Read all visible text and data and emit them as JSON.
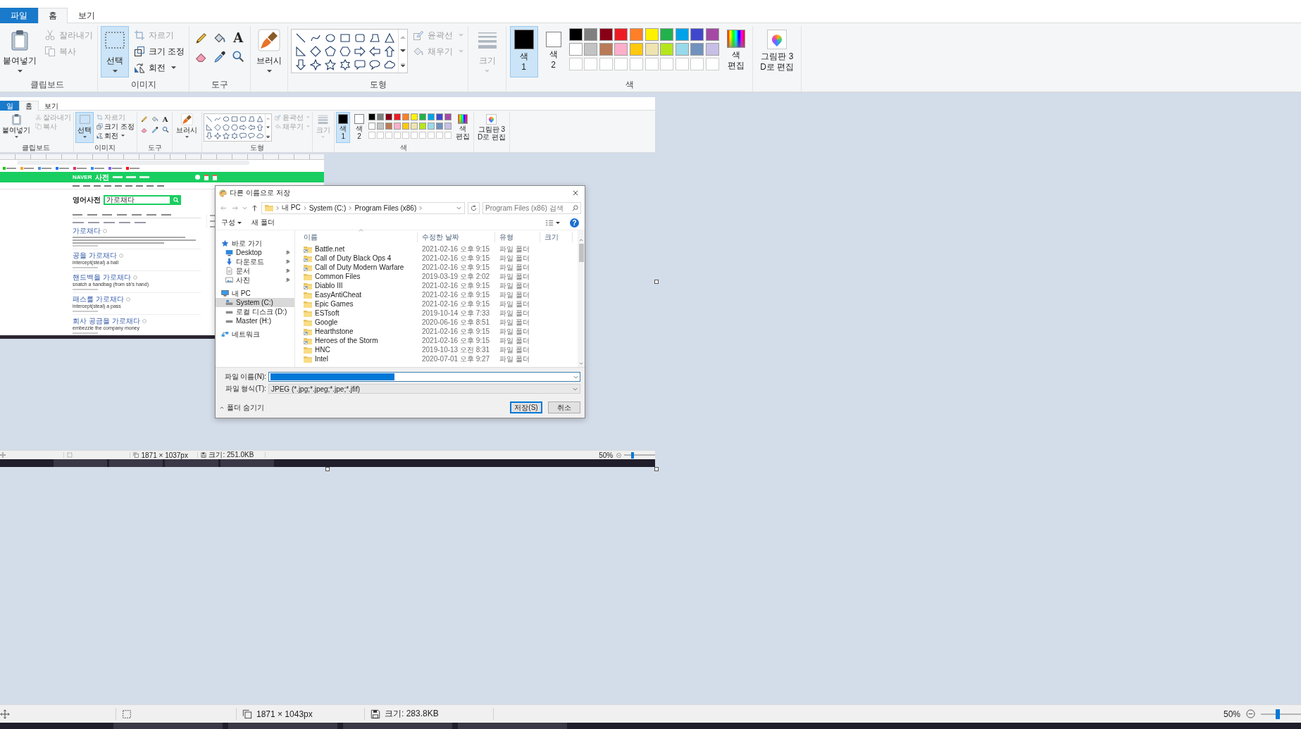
{
  "tabs": [
    {
      "label": "파일",
      "kind": "file",
      "selected": false
    },
    {
      "label": "홈",
      "kind": "tab",
      "selected": true
    },
    {
      "label": "보기",
      "kind": "tab",
      "selected": false
    }
  ],
  "ribbon": {
    "clipboard": {
      "label": "클립보드",
      "paste": "붙여넣기",
      "cut": {
        "label": "잘라내기",
        "disabled": true
      },
      "copy": {
        "label": "복사",
        "disabled": true
      }
    },
    "image": {
      "label": "이미지",
      "select": {
        "label": "선택",
        "selected": true
      },
      "crop": {
        "label": "자르기",
        "disabled": true
      },
      "resize": {
        "label": "크기 조정",
        "disabled": false
      },
      "rotate": {
        "label": "회전",
        "disabled": false
      }
    },
    "tools": {
      "label": "도구",
      "text_tool": "A"
    },
    "brushes": {
      "label": "브러시"
    },
    "shapes": {
      "label": "도형",
      "outline": {
        "label": "윤곽선",
        "disabled": true
      },
      "fill": {
        "label": "채우기",
        "disabled": true
      }
    },
    "size": {
      "label": "크기",
      "disabled": true
    },
    "colors": {
      "label": "색",
      "current": [
        {
          "lines": [
            "색",
            "1"
          ],
          "color": "#000000",
          "selected": true
        },
        {
          "lines": [
            "색",
            "2"
          ],
          "color": "#ffffff",
          "selected": false
        }
      ],
      "palette": [
        {
          "kind": "color",
          "color": "#000000"
        },
        {
          "kind": "color",
          "color": "#7f7f7f"
        },
        {
          "kind": "color",
          "color": "#880015"
        },
        {
          "kind": "color",
          "color": "#ed1c24"
        },
        {
          "kind": "color",
          "color": "#ff7f27"
        },
        {
          "kind": "color",
          "color": "#fff200"
        },
        {
          "kind": "color",
          "color": "#22b14c"
        },
        {
          "kind": "color",
          "color": "#00a2e8"
        },
        {
          "kind": "color",
          "color": "#3f48cc"
        },
        {
          "kind": "color",
          "color": "#a349a4"
        },
        {
          "kind": "color",
          "color": "#ffffff"
        },
        {
          "kind": "color",
          "color": "#c3c3c3"
        },
        {
          "kind": "color",
          "color": "#b97a57"
        },
        {
          "kind": "color",
          "color": "#ffaec9"
        },
        {
          "kind": "color",
          "color": "#ffc90e"
        },
        {
          "kind": "color",
          "color": "#efe4b0"
        },
        {
          "kind": "color",
          "color": "#b5e61d"
        },
        {
          "kind": "color",
          "color": "#99d9ea"
        },
        {
          "kind": "color",
          "color": "#7092be"
        },
        {
          "kind": "color",
          "color": "#c8bfe7"
        },
        {
          "kind": "empty"
        },
        {
          "kind": "empty"
        },
        {
          "kind": "empty"
        },
        {
          "kind": "empty"
        },
        {
          "kind": "empty"
        },
        {
          "kind": "empty"
        },
        {
          "kind": "empty"
        },
        {
          "kind": "empty"
        },
        {
          "kind": "empty"
        },
        {
          "kind": "empty"
        }
      ],
      "edit": {
        "lines": [
          "색",
          "편집"
        ]
      }
    },
    "paint3d": {
      "lines": [
        "그림판 3",
        "D로 편집"
      ]
    }
  },
  "canvas_image": {
    "tabs": [
      {
        "label": "일",
        "kind": "file",
        "selected": false
      },
      {
        "label": "홈",
        "kind": "tab",
        "selected": true
      },
      {
        "label": "보기",
        "kind": "tab",
        "selected": false
      }
    ],
    "ribbon": {
      "clipboard": {
        "label": "클립보드",
        "paste": "붙여넣기",
        "cut": {
          "label": "잘라내기",
          "disabled": true
        },
        "copy": {
          "label": "복사",
          "disabled": true
        }
      },
      "image": {
        "label": "이미지",
        "select": {
          "label": "선택",
          "selected": true
        },
        "crop": {
          "label": "자르기",
          "disabled": true
        },
        "resize": {
          "label": "크기 조정",
          "disabled": false
        },
        "rotate": {
          "label": "회전",
          "disabled": false
        }
      },
      "tools": {
        "label": "도구",
        "text_tool": "A"
      },
      "brushes": {
        "label": "브러시"
      },
      "shapes": {
        "label": "도형",
        "outline": {
          "label": "윤곽선",
          "disabled": true
        },
        "fill": {
          "label": "채우기",
          "disabled": true
        }
      },
      "size": {
        "label": "크기",
        "disabled": true
      },
      "colors": {
        "label": "색",
        "current": [
          {
            "lines": [
              "색",
              "1"
            ],
            "color": "#000000",
            "selected": true
          },
          {
            "lines": [
              "색",
              "2"
            ],
            "color": "#ffffff",
            "selected": false
          }
        ],
        "palette": [
          {
            "kind": "color",
            "color": "#000000"
          },
          {
            "kind": "color",
            "color": "#7f7f7f"
          },
          {
            "kind": "color",
            "color": "#880015"
          },
          {
            "kind": "color",
            "color": "#ed1c24"
          },
          {
            "kind": "color",
            "color": "#ff7f27"
          },
          {
            "kind": "color",
            "color": "#fff200"
          },
          {
            "kind": "color",
            "color": "#22b14c"
          },
          {
            "kind": "color",
            "color": "#00a2e8"
          },
          {
            "kind": "color",
            "color": "#3f48cc"
          },
          {
            "kind": "color",
            "color": "#a349a4"
          },
          {
            "kind": "color",
            "color": "#ffffff"
          },
          {
            "kind": "color",
            "color": "#c3c3c3"
          },
          {
            "kind": "color",
            "color": "#b97a57"
          },
          {
            "kind": "color",
            "color": "#ffaec9"
          },
          {
            "kind": "color",
            "color": "#ffc90e"
          },
          {
            "kind": "color",
            "color": "#efe4b0"
          },
          {
            "kind": "color",
            "color": "#b5e61d"
          },
          {
            "kind": "color",
            "color": "#99d9ea"
          },
          {
            "kind": "color",
            "color": "#7092be"
          },
          {
            "kind": "color",
            "color": "#c8bfe7"
          },
          {
            "kind": "empty"
          },
          {
            "kind": "empty"
          },
          {
            "kind": "empty"
          },
          {
            "kind": "empty"
          },
          {
            "kind": "empty"
          },
          {
            "kind": "empty"
          },
          {
            "kind": "empty"
          },
          {
            "kind": "empty"
          },
          {
            "kind": "empty"
          },
          {
            "kind": "empty"
          }
        ],
        "edit": {
          "lines": [
            "색",
            "편집"
          ]
        }
      },
      "paint3d": {
        "lines": [
          "그림판 3",
          "D로 편집"
        ]
      }
    },
    "browser": {
      "logo": "NAVER",
      "site": "사전",
      "page_title": "영어사전",
      "search_value": "가로채다",
      "results": [
        {
          "kind": "entry",
          "title": "가로채다"
        },
        {
          "kind": "phrase",
          "title": "공을 가로채다",
          "meaning": "intercept(steal) a ball"
        },
        {
          "kind": "phrase",
          "title": "핸드백을 가로채다",
          "meaning": "snatch a handbag (from sb's hand)"
        },
        {
          "kind": "phrase",
          "title": "패스를 가로채다",
          "meaning": "intercept(steal) a pass"
        },
        {
          "kind": "phrase",
          "title": "회사 공금을 가로채다",
          "meaning": "embezzle the company money"
        }
      ]
    },
    "save_dialog": {
      "title": "다른 이름으로 저장",
      "path": [
        "내 PC",
        "System (C:)",
        "Program Files (x86)"
      ],
      "search_placeholder": "Program Files (x86) 검색",
      "toolbar": {
        "organize": "구성",
        "new_folder": "새 폴더",
        "help": "?"
      },
      "nav": [
        {
          "label": "바로 가기",
          "kind": "star",
          "pinned": false,
          "selected": false,
          "children": [
            {
              "label": "Desktop",
              "kind": "desktop",
              "pinned": true,
              "selected": false
            },
            {
              "label": "다운로드",
              "kind": "download",
              "pinned": true,
              "selected": false
            },
            {
              "label": "문서",
              "kind": "document",
              "pinned": true,
              "selected": false
            },
            {
              "label": "사진",
              "kind": "picture",
              "pinned": true,
              "selected": false
            }
          ]
        },
        {
          "label": "내 PC",
          "kind": "pc",
          "pinned": false,
          "selected": false,
          "children": [
            {
              "label": "System (C:)",
              "kind": "system_drive",
              "pinned": false,
              "selected": true
            },
            {
              "label": "로컬 디스크 (D:)",
              "kind": "drive",
              "pinned": false,
              "selected": false
            },
            {
              "label": "Master (H:)",
              "kind": "drive",
              "pinned": false,
              "selected": false
            }
          ]
        },
        {
          "label": "네트워크",
          "kind": "network",
          "pinned": false,
          "selected": false
        }
      ],
      "columns": [
        "이름",
        "수정한 날짜",
        "유형",
        "크기"
      ],
      "rows": [
        {
          "name": "Battle.net",
          "date": "2021-02-16 오후 9:15",
          "type": "파일 폴더",
          "shortcut": true,
          "selected": false
        },
        {
          "name": "Call of Duty Black Ops 4",
          "date": "2021-02-16 오후 9:15",
          "type": "파일 폴더",
          "shortcut": true,
          "selected": false
        },
        {
          "name": "Call of Duty Modern Warfare",
          "date": "2021-02-16 오후 9:15",
          "type": "파일 폴더",
          "shortcut": true,
          "selected": false
        },
        {
          "name": "Common Files",
          "date": "2019-03-19 오후 2:02",
          "type": "파일 폴더",
          "shortcut": false,
          "selected": false
        },
        {
          "name": "Diablo III",
          "date": "2021-02-16 오후 9:15",
          "type": "파일 폴더",
          "shortcut": true,
          "selected": false
        },
        {
          "name": "EasyAntiCheat",
          "date": "2021-02-16 오후 9:15",
          "type": "파일 폴더",
          "shortcut": false,
          "selected": false
        },
        {
          "name": "Epic Games",
          "date": "2021-02-16 오후 9:15",
          "type": "파일 폴더",
          "shortcut": false,
          "selected": false
        },
        {
          "name": "ESTsoft",
          "date": "2019-10-14 오후 7:33",
          "type": "파일 폴더",
          "shortcut": false,
          "selected": false
        },
        {
          "name": "Google",
          "date": "2020-06-16 오후 8:51",
          "type": "파일 폴더",
          "shortcut": false,
          "selected": false
        },
        {
          "name": "Hearthstone",
          "date": "2021-02-16 오후 9:15",
          "type": "파일 폴더",
          "shortcut": true,
          "selected": false
        },
        {
          "name": "Heroes of the Storm",
          "date": "2021-02-16 오후 9:15",
          "type": "파일 폴더",
          "shortcut": true,
          "selected": false
        },
        {
          "name": "HNC",
          "date": "2019-10-13 오전 8:31",
          "type": "파일 폴더",
          "shortcut": false,
          "selected": false
        },
        {
          "name": "Intel",
          "date": "2020-07-01 오후 9:27",
          "type": "파일 폴더",
          "shortcut": false,
          "selected": false
        }
      ],
      "file_name_label": "파일 이름(N):",
      "file_type_label": "파일 형식(T):",
      "file_type": "JPEG (*.jpg;*.jpeg;*.jpe;*.jfif)",
      "hide_folders": "폴더 숨기기",
      "buttons": [
        {
          "label": "저장(S)",
          "kind": "primary"
        },
        {
          "label": "취소",
          "kind": "secondary"
        }
      ]
    },
    "status_bar": {
      "dimensions": "1871 × 1037px",
      "file_size": "크기: 251.0KB",
      "zoom": "50%",
      "zoom_slider": {
        "level": 0.28
      }
    }
  },
  "status_bar": {
    "dimensions": "1871 × 1043px",
    "file_size": "크기: 283.8KB",
    "zoom": "50%",
    "zoom_slider": {
      "level": 0.42
    }
  }
}
